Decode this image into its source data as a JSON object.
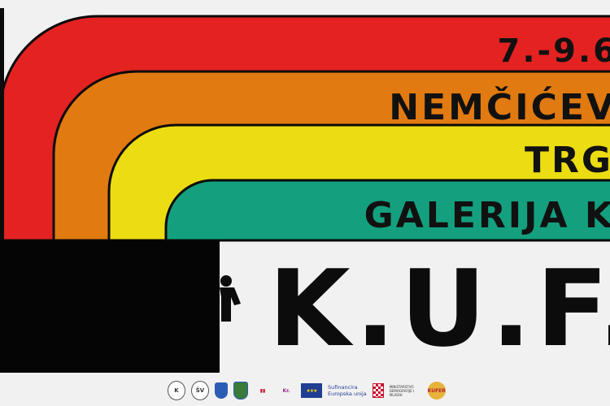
{
  "poster": {
    "dates": "7.-9.6",
    "place_line": "NEMČIĆEV",
    "square_line": "TRG",
    "gallery_line": "GALERIJA K",
    "brand_word": "K.U.F.E.R"
  },
  "colors": {
    "red": "#e42221",
    "orange": "#e17a10",
    "yellow": "#ecdc12",
    "green": "#14a07e",
    "black": "#050505",
    "background": "#f1f1f1"
  },
  "partners": {
    "logo1": "K",
    "logo2": "ŠV",
    "logo5": "Kr.",
    "eu_line1": "Sufinancira",
    "eu_line2": "Europska unija",
    "ministry_line1": "MINISTARSTVO",
    "ministry_line2": "DEMOGRAFIJE I MLADIH",
    "kufer_badge": "KUFER"
  }
}
